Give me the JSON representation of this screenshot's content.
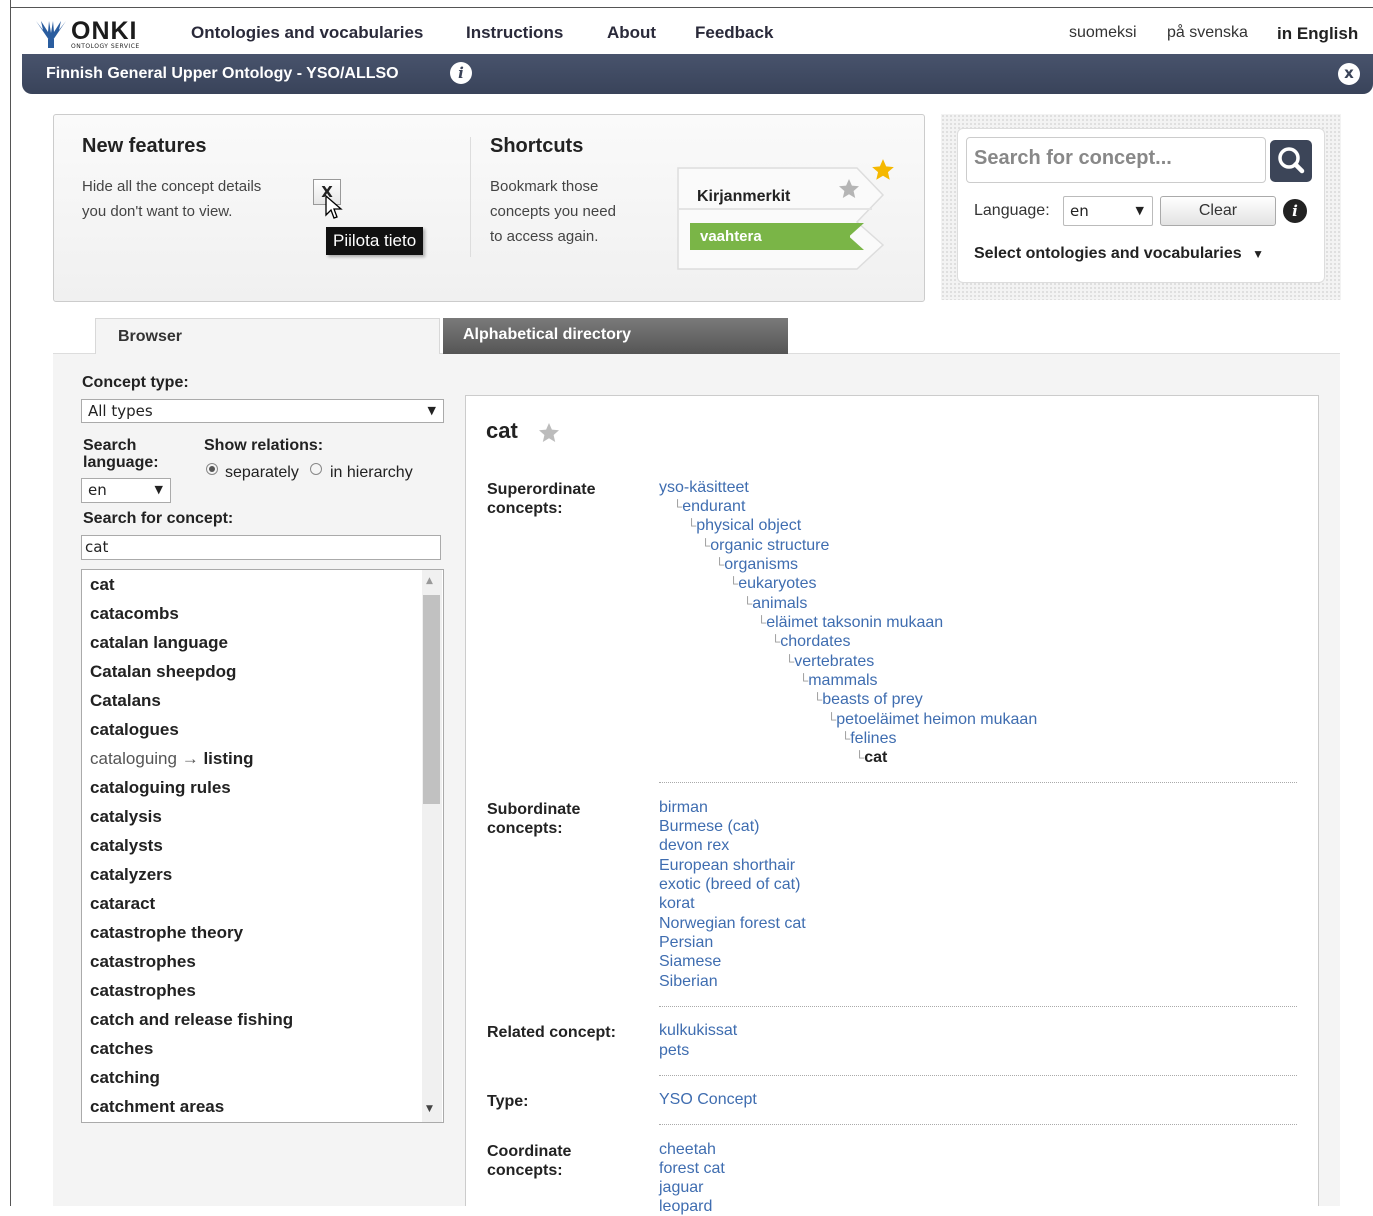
{
  "nav": {
    "logo_text": "ONKI",
    "logo_sub": "ONTOLOGY SERVICE",
    "items": [
      "Ontologies and vocabularies",
      "Instructions",
      "About",
      "Feedback"
    ],
    "languages": [
      "suomeksi",
      "på svenska",
      "in English"
    ]
  },
  "titlebar": {
    "title": "Finnish General Upper Ontology - YSO/ALLSO",
    "info_glyph": "i",
    "close_glyph": "x"
  },
  "features": {
    "new_title": "New features",
    "new_line1": "Hide all the concept details",
    "new_line2": "you don't want to view.",
    "x_label": "X",
    "tooltip": "Piilota tieto",
    "short_title": "Shortcuts",
    "short_line1": "Bookmark those",
    "short_line2": "concepts you need",
    "short_line3": "to access again.",
    "bookmarks_title": "Kirjanmerkit",
    "bookmark_item": "vaahtera"
  },
  "search": {
    "placeholder": "Search for concept...",
    "language_label": "Language:",
    "language_value": "en",
    "clear_label": "Clear",
    "select_onto": "Select ontologies and vocabularies"
  },
  "tabs": {
    "browser": "Browser",
    "alpha": "Alphabetical directory"
  },
  "left": {
    "concept_type_label": "Concept type:",
    "concept_type_value": "All types",
    "search_lang_label": "Search language:",
    "search_lang_line1": "Search",
    "search_lang_line2": "language:",
    "search_lang_value": "en",
    "show_relations_label": "Show relations:",
    "radio_separately": "separately",
    "radio_hierarchy": "in hierarchy",
    "search_concept_label": "Search for concept:",
    "search_concept_value": "cat",
    "results": [
      "cat",
      "catacombs",
      "catalan language",
      "Catalan sheepdog",
      "Catalans",
      "catalogues",
      "cataloguing",
      "cataloguing rules",
      "catalysis",
      "catalysts",
      "catalyzers",
      "cataract",
      "catastrophe theory",
      "catastrophes",
      "catastrophes",
      "catch and release fishing",
      "catches",
      "catching",
      "catchment areas"
    ],
    "results_6_arrow": "→",
    "results_6_target": "listing"
  },
  "concept": {
    "title": "cat",
    "superordinate_label": "Superordinate concepts:",
    "super_l1": "Superordinate",
    "super_l2": "concepts:",
    "hierarchy": [
      "yso-käsitteet",
      "endurant",
      "physical object",
      "organic structure",
      "organisms",
      "eukaryotes",
      "animals",
      "eläimet taksonin mukaan",
      "chordates",
      "vertebrates",
      "mammals",
      "beasts of prey",
      "petoeläimet heimon mukaan",
      "felines",
      "cat"
    ],
    "subordinate_label": "Subordinate concepts:",
    "sub_l1": "Subordinate",
    "sub_l2": "concepts:",
    "subordinates": [
      "birman",
      "Burmese (cat)",
      "devon rex",
      "European shorthair",
      "exotic (breed of cat)",
      "korat",
      "Norwegian forest cat",
      "Persian",
      "Siamese",
      "Siberian"
    ],
    "related_label": "Related concept:",
    "related": [
      "kulkukissat",
      "pets"
    ],
    "type_label": "Type:",
    "type_value": "YSO Concept",
    "coordinate_label": "Coordinate concepts:",
    "coord_l1": "Coordinate",
    "coord_l2": "concepts:",
    "coordinates": [
      "cheetah",
      "forest cat",
      "jaguar",
      "leopard"
    ]
  },
  "colors": {
    "link": "#3f6db0",
    "titlebar": "#3f4960",
    "bookmark_green": "#7ab547",
    "star_gold": "#f5b800"
  }
}
